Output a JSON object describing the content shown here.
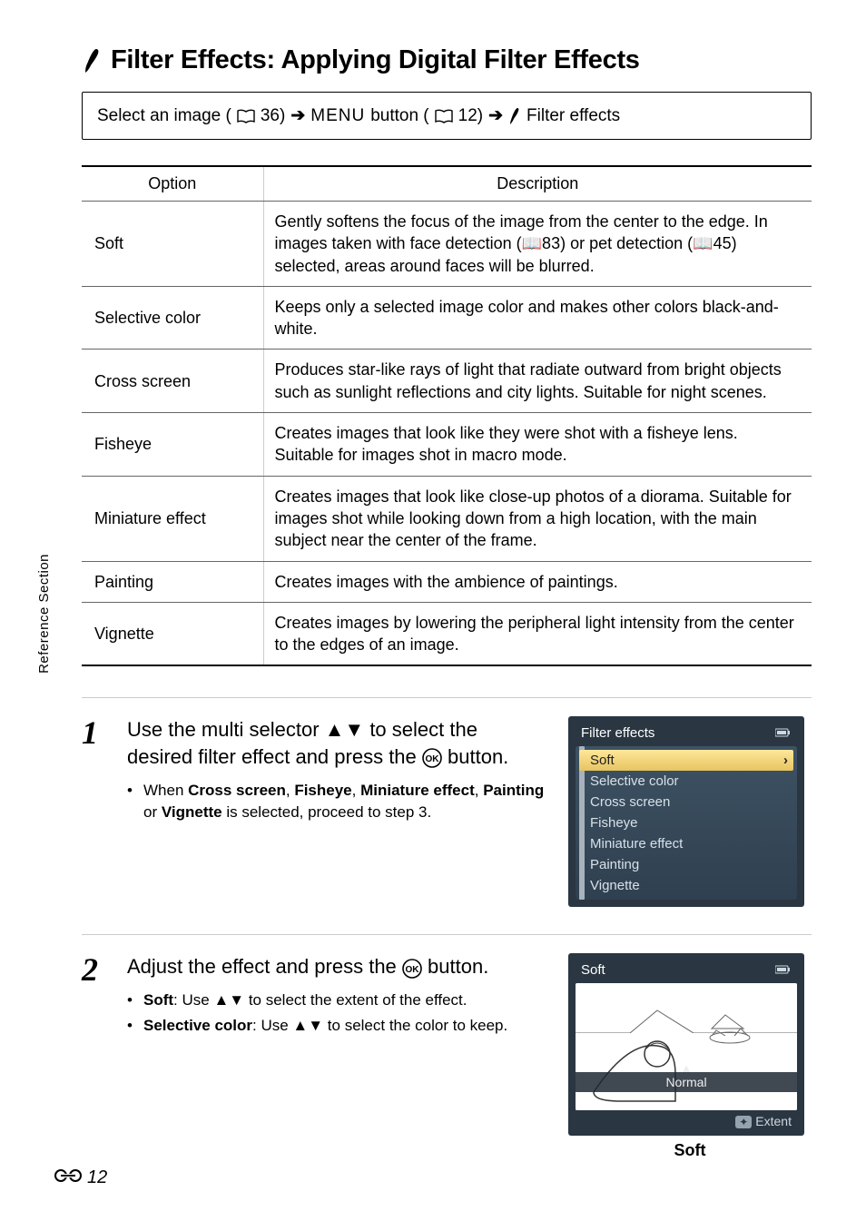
{
  "title": "Filter Effects: Applying Digital Filter Effects",
  "breadcrumb": {
    "select_image": "Select an image (",
    "ref1": "36) ",
    "menu_button": " button (",
    "ref2": "12) ",
    "filter_effects": " Filter effects",
    "menu_glyph": "MENU"
  },
  "table": {
    "header_option": "Option",
    "header_description": "Description",
    "rows": [
      {
        "option": "Soft",
        "description": "Gently softens the focus of the image from the center to the edge. In images taken with face detection (📖83) or pet detection (📖45) selected, areas around faces will be blurred."
      },
      {
        "option": "Selective color",
        "description": "Keeps only a selected image color and makes other colors black-and-white."
      },
      {
        "option": "Cross screen",
        "description": "Produces star-like rays of light that radiate outward from bright objects such as sunlight reflections and city lights. Suitable for night scenes."
      },
      {
        "option": "Fisheye",
        "description": "Creates images that look like they were shot with a fisheye lens. Suitable for images shot in macro mode."
      },
      {
        "option": "Miniature effect",
        "description": "Creates images that look like close-up photos of a diorama. Suitable for images shot while looking down from a high location, with the main subject near the center of the frame."
      },
      {
        "option": "Painting",
        "description": "Creates images with the ambience of paintings."
      },
      {
        "option": "Vignette",
        "description": "Creates images by lowering the peripheral light intensity from the center to the edges of an image."
      }
    ]
  },
  "sidebar_tab": "Reference Section",
  "steps": {
    "s1": {
      "num": "1",
      "title_a": "Use the multi selector ",
      "title_b": " to select the desired filter effect and press the ",
      "title_c": " button.",
      "bullet_prefix": "When ",
      "bullet_bold": [
        "Cross screen",
        "Fisheye",
        "Miniature effect",
        "Painting",
        "Vignette"
      ],
      "bullet_middle": " is selected, proceed to step 3."
    },
    "s2": {
      "num": "2",
      "title_a": "Adjust the effect and press the ",
      "title_b": " button.",
      "bullets": {
        "b1_label": "Soft",
        "b1_text": ": Use ▲▼ to select the extent of the effect.",
        "b2_label": "Selective color",
        "b2_text": ": Use ▲▼ to select the color to keep."
      }
    }
  },
  "lcd1": {
    "title": "Filter effects",
    "items": [
      "Soft",
      "Selective color",
      "Cross screen",
      "Fisheye",
      "Miniature effect",
      "Painting",
      "Vignette"
    ]
  },
  "lcd2": {
    "title": "Soft",
    "bar_label": "Normal",
    "footer_label": "Extent",
    "caption": "Soft"
  },
  "footer": {
    "page": "12"
  }
}
